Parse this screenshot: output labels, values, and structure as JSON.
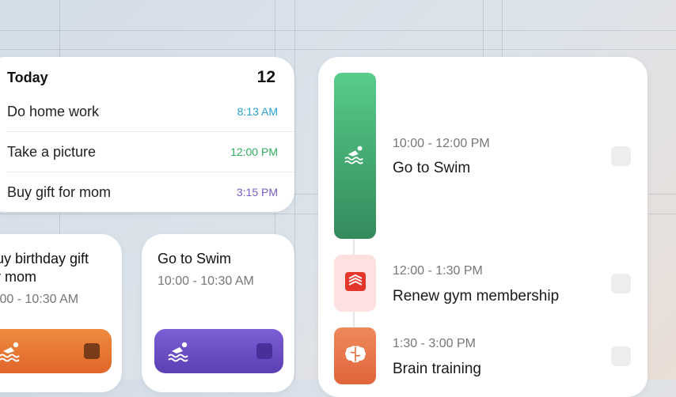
{
  "today_widget": {
    "title": "Today",
    "count": "12",
    "items": [
      {
        "label": "Do home work",
        "time": "8:13 AM",
        "color": "#2a9fd6"
      },
      {
        "label": "Take a picture",
        "time": "12:00 PM",
        "color": "#2fae5e"
      },
      {
        "label": "Buy gift for mom",
        "time": "3:15 PM",
        "color": "#7a5bbf"
      }
    ]
  },
  "small_widget_left": {
    "title_line1": "uy birthday gift",
    "title_line2": "r mom",
    "time": ":00 - 10:30 AM",
    "bar_color": "#e6702e",
    "icon": "swimmer-icon"
  },
  "small_widget_right": {
    "title": "Go to Swim",
    "time": "10:00 - 10:30 AM",
    "bar_color": "#6a4cc0",
    "icon": "swimmer-icon"
  },
  "timeline_widget": {
    "events": [
      {
        "time": "10:00 - 12:00 PM",
        "title": "Go to Swim",
        "icon": "swimmer-icon",
        "color": "#3ea56c"
      },
      {
        "time": "12:00 - 1:30 PM",
        "title": "Renew gym membership",
        "icon": "todoist-icon",
        "color": "#fde0e0"
      },
      {
        "time": "1:30 - 3:00 PM",
        "title": "Brain training",
        "icon": "brain-icon",
        "color": "#e8724a"
      }
    ]
  }
}
